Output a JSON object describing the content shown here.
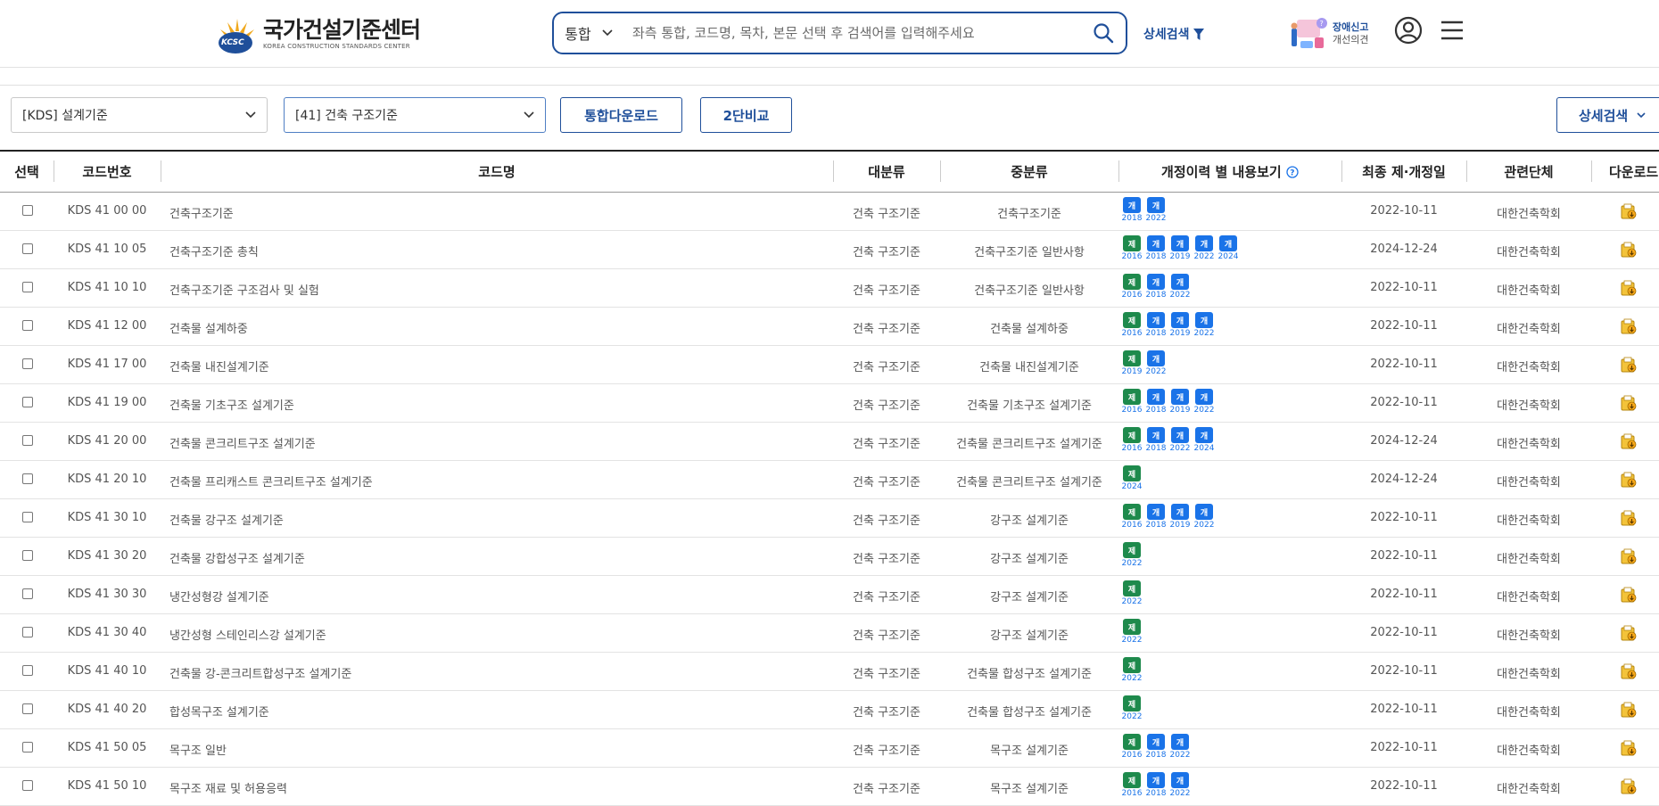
{
  "header": {
    "logo_ko": "국가건설기준센터",
    "logo_en": "KOREA CONSTRUCTION STANDARDS CENTER",
    "logo_badge": "KCSC",
    "search_scope": "통합",
    "search_placeholder": "좌측 통합, 코드명, 목차, 본문 선택 후 검색어를 입력해주세요",
    "advanced_search": "상세검색",
    "report_line1": "장애신고",
    "report_line2": "개선의견"
  },
  "filters": {
    "category_select": "[KDS] 설계기준",
    "sub_select": "[41] 건축 구조기준",
    "download_all": "통합다운로드",
    "compare": "2단비교",
    "advanced": "상세검색"
  },
  "table": {
    "headers": {
      "select": "선택",
      "code": "코드번호",
      "name": "코드명",
      "major": "대분류",
      "middle": "중분류",
      "history": "개정이력 별 내용보기",
      "date": "최종 제·개정일",
      "org": "관련단체",
      "download": "다운로드"
    },
    "badge_labels": {
      "je": "제",
      "gae": "개"
    },
    "rows": [
      {
        "code": "KDS 41 00 00",
        "name": "건축구조기준",
        "major": "건축 구조기준",
        "middle": "건축구조기준",
        "date": "2022-10-11",
        "org": "대한건축학회",
        "history": [
          {
            "type": "gae",
            "year": "2018"
          },
          {
            "type": "gae",
            "year": "2022"
          }
        ]
      },
      {
        "code": "KDS 41 10 05",
        "name": "건축구조기준 총칙",
        "major": "건축 구조기준",
        "middle": "건축구조기준 일반사항",
        "date": "2024-12-24",
        "org": "대한건축학회",
        "history": [
          {
            "type": "je",
            "year": "2016"
          },
          {
            "type": "gae",
            "year": "2018"
          },
          {
            "type": "gae",
            "year": "2019"
          },
          {
            "type": "gae",
            "year": "2022"
          },
          {
            "type": "gae",
            "year": "2024"
          }
        ]
      },
      {
        "code": "KDS 41 10 10",
        "name": "건축구조기준 구조검사 및 실험",
        "major": "건축 구조기준",
        "middle": "건축구조기준 일반사항",
        "date": "2022-10-11",
        "org": "대한건축학회",
        "history": [
          {
            "type": "je",
            "year": "2016"
          },
          {
            "type": "gae",
            "year": "2018"
          },
          {
            "type": "gae",
            "year": "2022"
          }
        ]
      },
      {
        "code": "KDS 41 12 00",
        "name": "건축물 설계하중",
        "major": "건축 구조기준",
        "middle": "건축물 설계하중",
        "date": "2022-10-11",
        "org": "대한건축학회",
        "history": [
          {
            "type": "je",
            "year": "2016"
          },
          {
            "type": "gae",
            "year": "2018"
          },
          {
            "type": "gae",
            "year": "2019"
          },
          {
            "type": "gae",
            "year": "2022"
          }
        ]
      },
      {
        "code": "KDS 41 17 00",
        "name": "건축물 내진설계기준",
        "major": "건축 구조기준",
        "middle": "건축물 내진설계기준",
        "date": "2022-10-11",
        "org": "대한건축학회",
        "history": [
          {
            "type": "je",
            "year": "2019"
          },
          {
            "type": "gae",
            "year": "2022"
          }
        ]
      },
      {
        "code": "KDS 41 19 00",
        "name": "건축물 기초구조 설계기준",
        "major": "건축 구조기준",
        "middle": "건축물 기초구조 설계기준",
        "date": "2022-10-11",
        "org": "대한건축학회",
        "history": [
          {
            "type": "je",
            "year": "2016"
          },
          {
            "type": "gae",
            "year": "2018"
          },
          {
            "type": "gae",
            "year": "2019"
          },
          {
            "type": "gae",
            "year": "2022"
          }
        ]
      },
      {
        "code": "KDS 41 20 00",
        "name": "건축물 콘크리트구조 설계기준",
        "major": "건축 구조기준",
        "middle": "건축물 콘크리트구조 설계기준",
        "date": "2024-12-24",
        "org": "대한건축학회",
        "history": [
          {
            "type": "je",
            "year": "2016"
          },
          {
            "type": "gae",
            "year": "2018"
          },
          {
            "type": "gae",
            "year": "2022"
          },
          {
            "type": "gae",
            "year": "2024"
          }
        ]
      },
      {
        "code": "KDS 41 20 10",
        "name": "건축물 프리캐스트 콘크리트구조 설계기준",
        "major": "건축 구조기준",
        "middle": "건축물 콘크리트구조 설계기준",
        "date": "2024-12-24",
        "org": "대한건축학회",
        "history": [
          {
            "type": "je",
            "year": "2024"
          }
        ]
      },
      {
        "code": "KDS 41 30 10",
        "name": "건축물 강구조 설계기준",
        "major": "건축 구조기준",
        "middle": "강구조 설계기준",
        "date": "2022-10-11",
        "org": "대한건축학회",
        "history": [
          {
            "type": "je",
            "year": "2016"
          },
          {
            "type": "gae",
            "year": "2018"
          },
          {
            "type": "gae",
            "year": "2019"
          },
          {
            "type": "gae",
            "year": "2022"
          }
        ]
      },
      {
        "code": "KDS 41 30 20",
        "name": "건축물 강합성구조 설계기준",
        "major": "건축 구조기준",
        "middle": "강구조 설계기준",
        "date": "2022-10-11",
        "org": "대한건축학회",
        "history": [
          {
            "type": "je",
            "year": "2022"
          }
        ]
      },
      {
        "code": "KDS 41 30 30",
        "name": "냉간성형강 설계기준",
        "major": "건축 구조기준",
        "middle": "강구조 설계기준",
        "date": "2022-10-11",
        "org": "대한건축학회",
        "history": [
          {
            "type": "je",
            "year": "2022"
          }
        ]
      },
      {
        "code": "KDS 41 30 40",
        "name": "냉간성형 스테인리스강 설계기준",
        "major": "건축 구조기준",
        "middle": "강구조 설계기준",
        "date": "2022-10-11",
        "org": "대한건축학회",
        "history": [
          {
            "type": "je",
            "year": "2022"
          }
        ]
      },
      {
        "code": "KDS 41 40 10",
        "name": "건축물 강-콘크리트합성구조 설계기준",
        "major": "건축 구조기준",
        "middle": "건축물 합성구조 설계기준",
        "date": "2022-10-11",
        "org": "대한건축학회",
        "history": [
          {
            "type": "je",
            "year": "2022"
          }
        ]
      },
      {
        "code": "KDS 41 40 20",
        "name": "합성목구조 설계기준",
        "major": "건축 구조기준",
        "middle": "건축물 합성구조 설계기준",
        "date": "2022-10-11",
        "org": "대한건축학회",
        "history": [
          {
            "type": "je",
            "year": "2022"
          }
        ]
      },
      {
        "code": "KDS 41 50 05",
        "name": "목구조 일반",
        "major": "건축 구조기준",
        "middle": "목구조 설계기준",
        "date": "2022-10-11",
        "org": "대한건축학회",
        "history": [
          {
            "type": "je",
            "year": "2016"
          },
          {
            "type": "gae",
            "year": "2018"
          },
          {
            "type": "gae",
            "year": "2022"
          }
        ]
      },
      {
        "code": "KDS 41 50 10",
        "name": "목구조 재료 및 허용응력",
        "major": "건축 구조기준",
        "middle": "목구조 설계기준",
        "date": "2022-10-11",
        "org": "대한건축학회",
        "history": [
          {
            "type": "je",
            "year": "2016"
          },
          {
            "type": "gae",
            "year": "2018"
          },
          {
            "type": "gae",
            "year": "2022"
          }
        ]
      }
    ]
  },
  "colors": {
    "brand": "#1f4f9a",
    "je_badge": "#1e8a4c",
    "gae_badge": "#1a73e8"
  }
}
